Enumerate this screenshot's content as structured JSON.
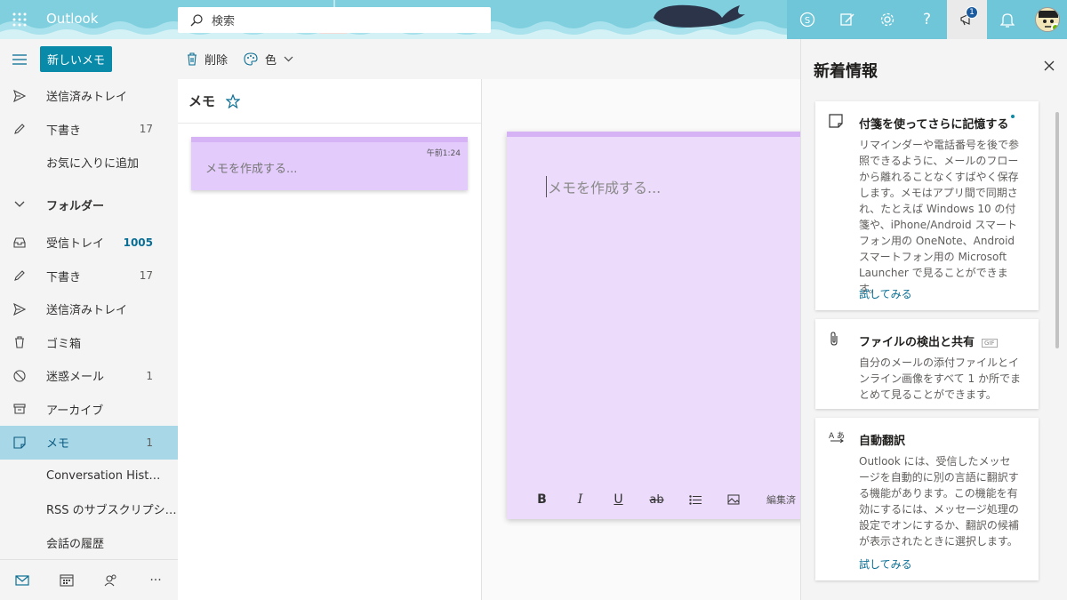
{
  "topbar": {
    "brand": "Outlook",
    "search_placeholder": "検索",
    "notification_count": "1"
  },
  "leftnav": {
    "new_button": "新しいメモ",
    "favorites": [
      {
        "label": "送信済みトレイ",
        "count": ""
      },
      {
        "label": "下書き",
        "count": "17"
      }
    ],
    "add_favorite": "お気に入りに追加",
    "folders_label": "フォルダー",
    "folders": [
      {
        "label": "受信トレイ",
        "count": "1005"
      },
      {
        "label": "下書き",
        "count": "17"
      },
      {
        "label": "送信済みトレイ",
        "count": ""
      },
      {
        "label": "ゴミ箱",
        "count": ""
      },
      {
        "label": "迷惑メール",
        "count": "1"
      },
      {
        "label": "アーカイブ",
        "count": ""
      },
      {
        "label": "メモ",
        "count": "1"
      },
      {
        "label": "Conversation Hist…",
        "count": ""
      },
      {
        "label": "RSS のサブスクリプシ…",
        "count": ""
      },
      {
        "label": "会話の履歴",
        "count": ""
      }
    ]
  },
  "toolbar": {
    "delete_label": "削除",
    "color_label": "色"
  },
  "notelist": {
    "title": "メモ",
    "card": {
      "time": "午前1:24",
      "placeholder": "メモを作成する..."
    }
  },
  "editor": {
    "placeholder": "メモを作成する...",
    "edit_label": "編集済"
  },
  "whatsnew": {
    "title": "新着情報",
    "cards": [
      {
        "title": "付箋を使ってさらに記憶する",
        "body": "リマインダーや電話番号を後で参照できるように、メールのフローから離れることなくすばやく保存します。メモはアプリ間で同期され、たとえば Windows 10 の付箋や、iPhone/Android スマートフォン用の OneNote、Android スマートフォン用の Microsoft Launcher で見ることができます。",
        "link": "試してみる"
      },
      {
        "title": "ファイルの検出と共有",
        "tag": "GIF",
        "body": "自分のメールの添付ファイルとインライン画像をすべて 1 か所でまとめて見ることができます。"
      },
      {
        "title": "自動翻訳",
        "body": "Outlook には、受信したメッセージを自動的に別の言語に翻訳する機能があります。この機能を有効にするには、メッセージ処理の設定でオンにするか、翻訳の候補が表示されたときに選択します。",
        "link": "試してみる"
      }
    ]
  },
  "colors": {
    "accent": "#0a8aa9",
    "note_fill": "#ecdbfb",
    "note_header": "#d6b3f5",
    "selected_nav": "#a8d8e8"
  }
}
